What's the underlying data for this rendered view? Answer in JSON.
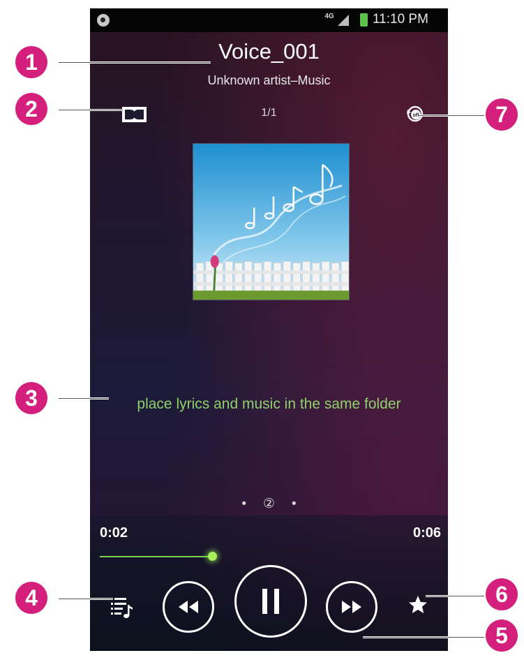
{
  "status_bar": {
    "network": "4G",
    "time": "11:10 PM",
    "icons": [
      "app-notification-icon",
      "signal-icon",
      "battery-icon"
    ]
  },
  "player": {
    "title": "Voice_001",
    "artist_album": "Unknown artist–Music",
    "track_position": "1/1",
    "lyrics": "place lyrics and music in the same folder",
    "page_indicator": "②",
    "elapsed": "0:02",
    "duration": "0:06",
    "progress_fraction": 0.33,
    "icons": {
      "sound_effect": "dolby-icon",
      "repeat": "repeat-off-icon",
      "playlist": "playlist-icon",
      "rewind": "rewind-icon",
      "pause": "pause-icon",
      "forward": "fast-forward-icon",
      "favorite": "star-icon"
    },
    "colors": {
      "lyrics": "#8ed06a",
      "progress": "#7ccf4c",
      "callout": "#d4207c"
    }
  },
  "callouts": [
    "1",
    "2",
    "3",
    "4",
    "5",
    "6",
    "7"
  ]
}
